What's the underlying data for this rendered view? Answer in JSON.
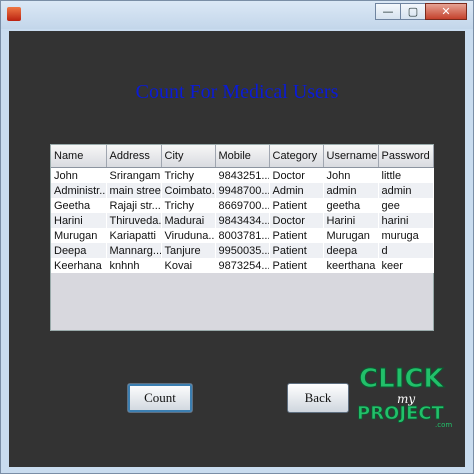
{
  "window": {
    "controls": {
      "minimize": "—",
      "restore": "▢",
      "close": "✕"
    }
  },
  "heading": "Count For Medical Users",
  "table": {
    "columns": [
      "Name",
      "Address",
      "City",
      "Mobile",
      "Category",
      "Username",
      "Password"
    ],
    "rows": [
      [
        "John",
        "Srirangam",
        "Trichy",
        "9843251...",
        "Doctor",
        "John",
        "little"
      ],
      [
        "Administr...",
        "main street",
        "Coimbato...",
        "9948700...",
        "Admin",
        "admin",
        "admin"
      ],
      [
        "Geetha",
        "Rajaji str...",
        "Trichy",
        "8669700...",
        "Patient",
        "geetha",
        "gee"
      ],
      [
        "Harini",
        "Thiruveda...",
        "Madurai",
        "9843434...",
        "Doctor",
        "Harini",
        "harini"
      ],
      [
        "Murugan",
        "Kariapatti",
        "Viruduna...",
        "8003781...",
        "Patient",
        "Murugan",
        "muruga"
      ],
      [
        "Deepa",
        "Mannarg...",
        "Tanjure",
        "9950035...",
        "Patient",
        "deepa",
        "d"
      ],
      [
        "Keerhana",
        "knhnh",
        "Kovai",
        "9873254...",
        "Patient",
        "keerthana",
        "keer"
      ]
    ]
  },
  "buttons": {
    "count": "Count",
    "back": "Back"
  },
  "logo": {
    "line1": "CLICK",
    "line2": "my",
    "line3": "PROJECT",
    "suffix": ".com"
  },
  "colors": {
    "heading": "#0a1bd6",
    "panel": "#333333",
    "logo_green": "#22c06a"
  }
}
